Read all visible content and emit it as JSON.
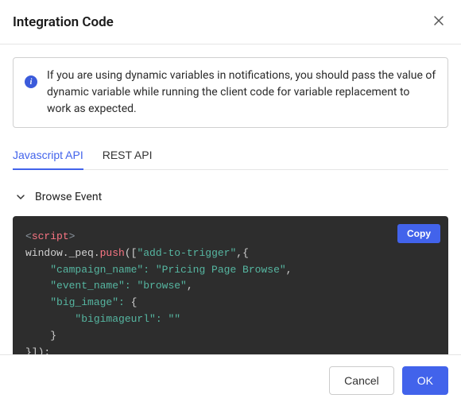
{
  "header": {
    "title": "Integration Code"
  },
  "info": {
    "text": "If you are using dynamic variables in notifications, you should pass the value of dynamic variable while running the client code for variable replacement to work as expected."
  },
  "tabs": {
    "items": [
      "Javascript API",
      "REST API"
    ],
    "active": 0
  },
  "accordion": {
    "title": "Browse Event",
    "expanded": true
  },
  "copy_label": "Copy",
  "code": {
    "l1_open": "<",
    "l1_tag": "script",
    "l1_close": ">",
    "l2_a": "window._peq.",
    "l2_b": "push",
    "l2_c": "([",
    "l2_d": "\"add-to-trigger\"",
    "l2_e": ",{",
    "l3_a": "    ",
    "l3_b": "\"campaign_name\": ",
    "l3_c": "\"Pricing Page Browse\"",
    "l3_d": ",",
    "l4_a": "    ",
    "l4_b": "\"event_name\": ",
    "l4_c": "\"browse\"",
    "l4_d": ",",
    "l5_a": "    ",
    "l5_b": "\"big_image\": ",
    "l5_c": "{",
    "l6_a": "        ",
    "l6_b": "\"bigimageurl\": ",
    "l6_c": "\"\"",
    "l7_a": "    }",
    "l8_a": "}]);"
  },
  "footer": {
    "cancel": "Cancel",
    "ok": "OK"
  }
}
